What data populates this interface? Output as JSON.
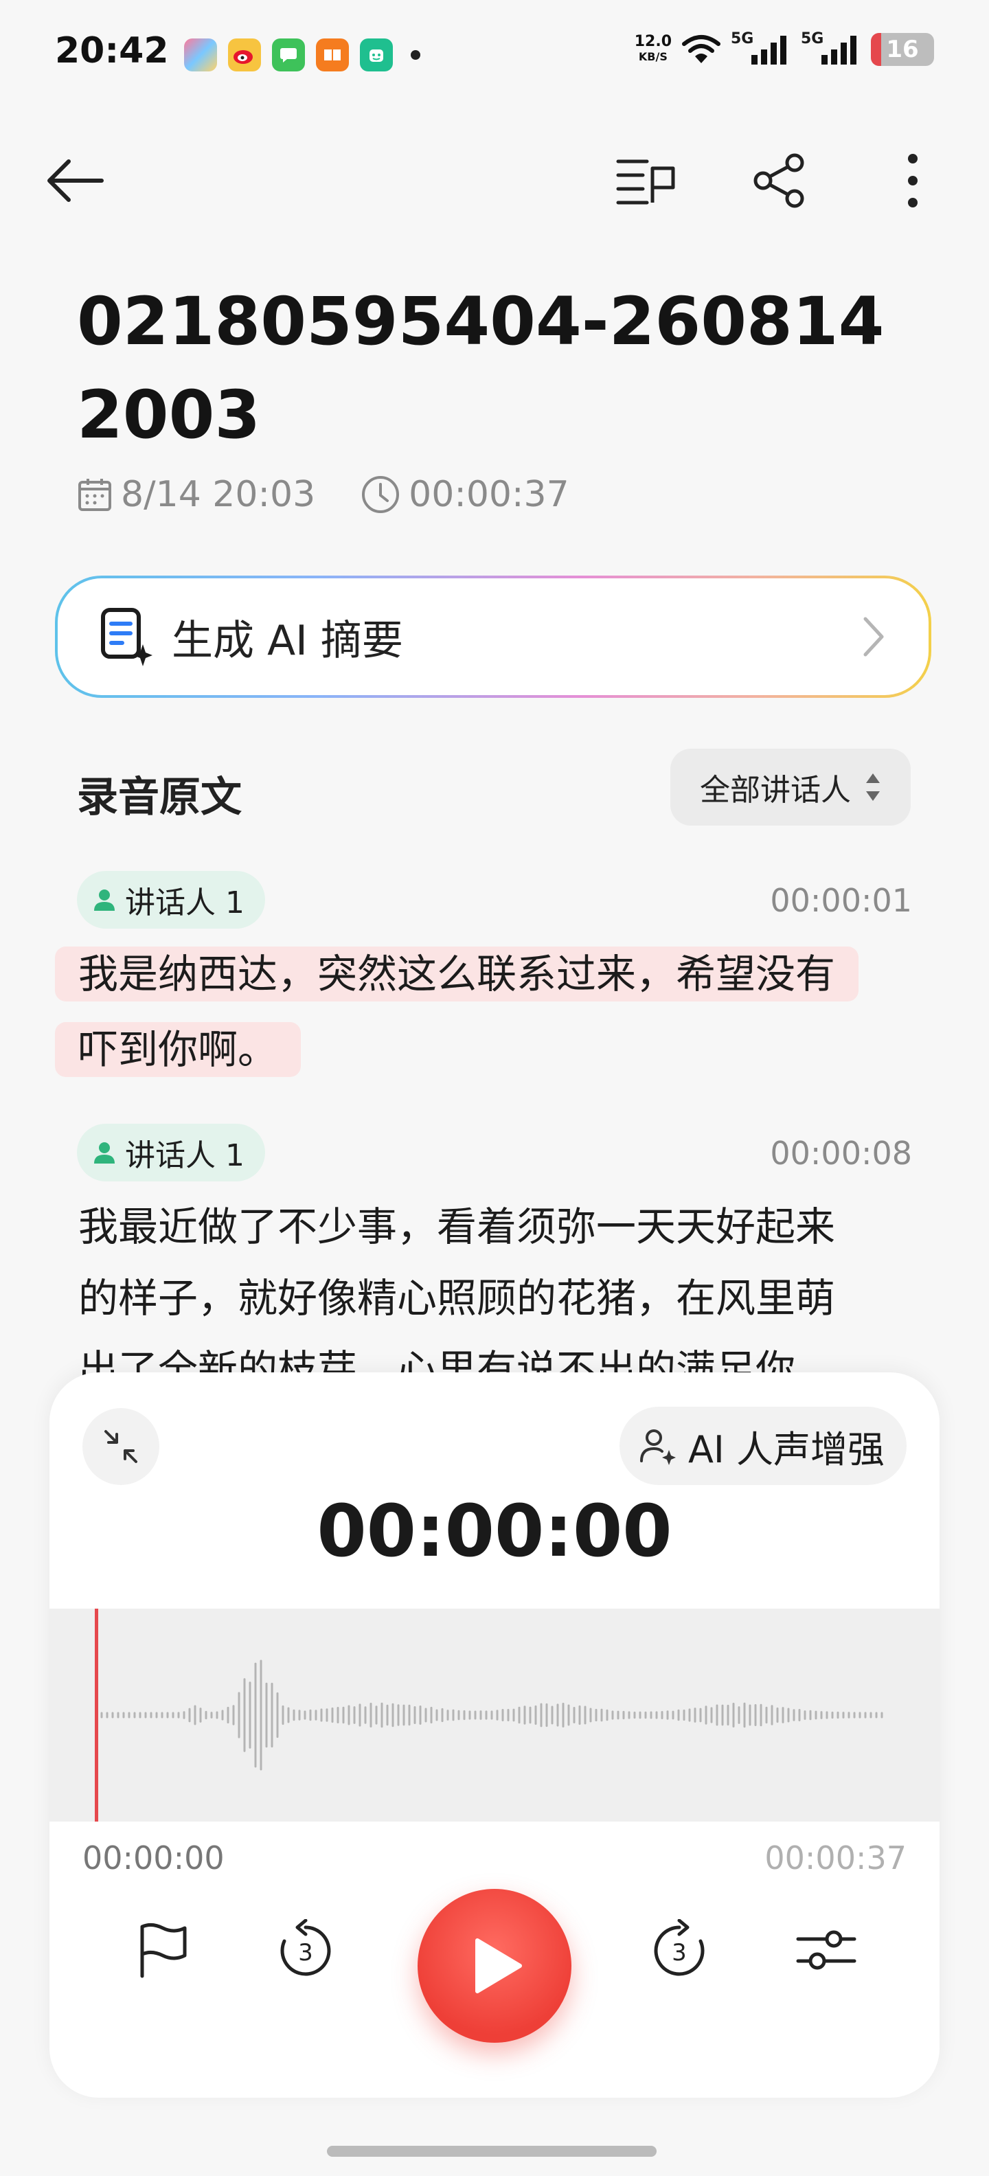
{
  "status_bar": {
    "time": "20:42",
    "net_speed_value": "12.0",
    "net_speed_unit": "KB/S",
    "network_1": "5G",
    "network_2": "5G",
    "battery": "16",
    "notification_icons": [
      "photos-app-icon",
      "weibo-icon",
      "messages-icon",
      "books-icon",
      "mihome-icon"
    ]
  },
  "recording": {
    "title": "02180595404-2608142003",
    "date": "8/14 20:03",
    "duration": "00:00:37"
  },
  "ai_summary": {
    "label": "生成 AI 摘要"
  },
  "transcript": {
    "section_title": "录音原文",
    "speaker_filter": "全部讲话人",
    "entries": [
      {
        "speaker": "讲话人 1",
        "timestamp": "00:00:01",
        "line1": "我是纳西达，突然这么联系过来，希望没有",
        "line2": "吓到你啊。"
      },
      {
        "speaker": "讲话人 1",
        "timestamp": "00:00:08",
        "line1": "我最近做了不少事，看着须弥一天天好起来",
        "line2": "的样子，就好像精心照顾的花猪，在风里萌",
        "line3": "出了全新的枝芽，心里有说不出的满足你"
      }
    ]
  },
  "player": {
    "enhance_label": "AI 人声增强",
    "current_time": "00:00:00",
    "start_time": "00:00:00",
    "end_time": "00:00:37",
    "skip_back_seconds": "3",
    "skip_forward_seconds": "3",
    "progress": 0.0
  },
  "colors": {
    "accent_red": "#ee3f37",
    "speaker_chip_bg": "#e3f3ec",
    "speaker_icon": "#2fb47c",
    "highlight_bg": "#fbe4e4"
  }
}
